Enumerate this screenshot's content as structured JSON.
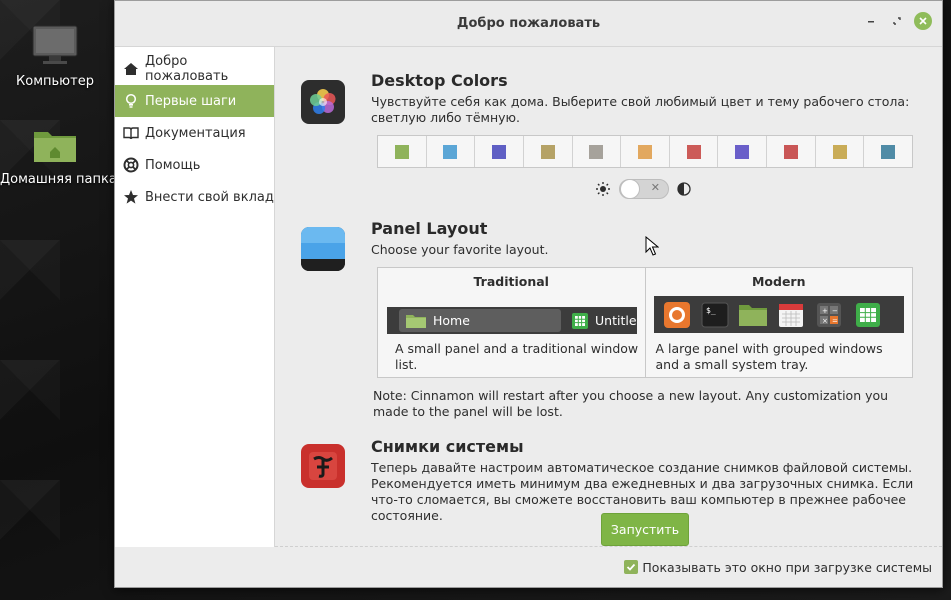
{
  "desktop": {
    "icons": [
      {
        "label": "Компьютер"
      },
      {
        "label": "Домашняя папка"
      }
    ]
  },
  "window": {
    "title": "Добро пожаловать"
  },
  "sidebar": {
    "items": [
      {
        "label": "Добро пожаловать",
        "icon": "home-icon"
      },
      {
        "label": "Первые шаги",
        "icon": "lightbulb-icon",
        "active": true
      },
      {
        "label": "Документация",
        "icon": "book-icon"
      },
      {
        "label": "Помощь",
        "icon": "lifebuoy-icon"
      },
      {
        "label": "Внести свой вклад",
        "icon": "star-icon"
      }
    ]
  },
  "colors_section": {
    "title": "Desktop Colors",
    "text": "Чувствуйте себя как дома. Выберите свой любимый цвет и тему рабочего стола: светлую либо тёмную.",
    "swatches": [
      "#8fb35b",
      "#5ba6d6",
      "#5f5fc4",
      "#b5a266",
      "#a6a29b",
      "#e2a85f",
      "#cc5b58",
      "#6a5fc9",
      "#c95656",
      "#c9ac57",
      "#4f8ba6"
    ],
    "theme_switch_state": "light"
  },
  "panel_section": {
    "title": "Panel Layout",
    "text": "Choose your favorite layout.",
    "traditional": {
      "title": "Traditional",
      "desc": "A small panel and a traditional window list.",
      "button1": "Home",
      "button2": "Untitle"
    },
    "modern": {
      "title": "Modern",
      "desc": "A large panel with grouped windows and a small system tray."
    },
    "note": "Note: Cinnamon will restart after you choose a new layout. Any customization you made to the panel will be lost."
  },
  "snapshot_section": {
    "title": "Снимки системы",
    "text": "Теперь давайте настроим автоматическое создание снимков файловой системы. Рекомендуется иметь минимум два ежедневных и два загрузочных снимка. Если что-то сломается, вы сможете восстановить ваш компьютер в прежнее рабочее состояние.",
    "button": "Запустить"
  },
  "footer": {
    "checkbox_label": "Показывать это окно при загрузке системы",
    "checked": true
  }
}
